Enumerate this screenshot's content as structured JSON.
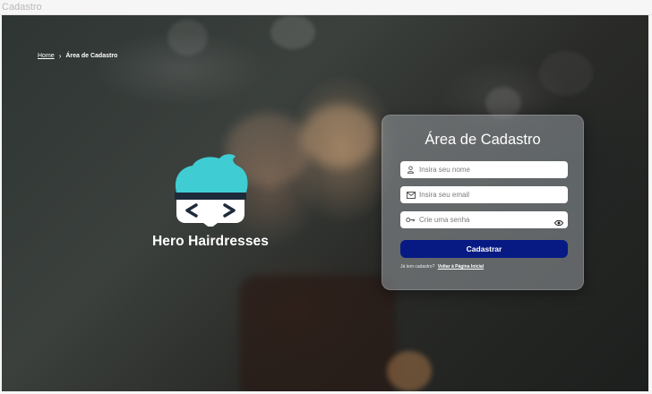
{
  "window": {
    "title": "Cadastro"
  },
  "breadcrumb": {
    "home": "Home",
    "separator": "›",
    "current": "Área de Cadastro"
  },
  "brand": {
    "name": "Hero Hairdresses",
    "logo_symbol": "< >",
    "hair_color": "#3fcdd3"
  },
  "form": {
    "title": "Área de Cadastro",
    "name_placeholder": "Insira seu nome",
    "email_placeholder": "Insira seu email",
    "password_placeholder": "Crie uma senha",
    "submit_label": "Cadastrar",
    "already_registered": "Já tem cadastro?",
    "back_link": "Voltar à Página Inicial"
  },
  "colors": {
    "accent": "#071a84",
    "card_bg": "#969ba0"
  },
  "icons": {
    "name_field": "user-icon",
    "email_field": "mail-icon",
    "password_field": "key-icon",
    "toggle_password": "eye-icon",
    "breadcrumb_separator": "chevron-right-icon"
  }
}
